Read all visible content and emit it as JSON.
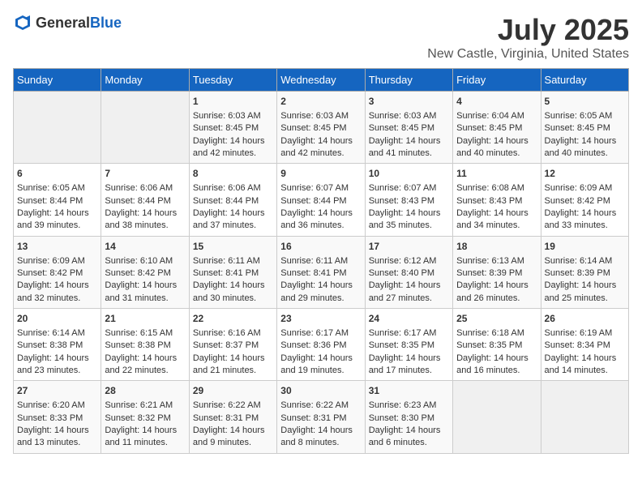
{
  "header": {
    "logo_general": "General",
    "logo_blue": "Blue",
    "title": "July 2025",
    "subtitle": "New Castle, Virginia, United States"
  },
  "weekdays": [
    "Sunday",
    "Monday",
    "Tuesday",
    "Wednesday",
    "Thursday",
    "Friday",
    "Saturday"
  ],
  "weeks": [
    [
      {
        "day": "",
        "info": ""
      },
      {
        "day": "",
        "info": ""
      },
      {
        "day": "1",
        "info": "Sunrise: 6:03 AM\nSunset: 8:45 PM\nDaylight: 14 hours\nand 42 minutes."
      },
      {
        "day": "2",
        "info": "Sunrise: 6:03 AM\nSunset: 8:45 PM\nDaylight: 14 hours\nand 42 minutes."
      },
      {
        "day": "3",
        "info": "Sunrise: 6:03 AM\nSunset: 8:45 PM\nDaylight: 14 hours\nand 41 minutes."
      },
      {
        "day": "4",
        "info": "Sunrise: 6:04 AM\nSunset: 8:45 PM\nDaylight: 14 hours\nand 40 minutes."
      },
      {
        "day": "5",
        "info": "Sunrise: 6:05 AM\nSunset: 8:45 PM\nDaylight: 14 hours\nand 40 minutes."
      }
    ],
    [
      {
        "day": "6",
        "info": "Sunrise: 6:05 AM\nSunset: 8:44 PM\nDaylight: 14 hours\nand 39 minutes."
      },
      {
        "day": "7",
        "info": "Sunrise: 6:06 AM\nSunset: 8:44 PM\nDaylight: 14 hours\nand 38 minutes."
      },
      {
        "day": "8",
        "info": "Sunrise: 6:06 AM\nSunset: 8:44 PM\nDaylight: 14 hours\nand 37 minutes."
      },
      {
        "day": "9",
        "info": "Sunrise: 6:07 AM\nSunset: 8:44 PM\nDaylight: 14 hours\nand 36 minutes."
      },
      {
        "day": "10",
        "info": "Sunrise: 6:07 AM\nSunset: 8:43 PM\nDaylight: 14 hours\nand 35 minutes."
      },
      {
        "day": "11",
        "info": "Sunrise: 6:08 AM\nSunset: 8:43 PM\nDaylight: 14 hours\nand 34 minutes."
      },
      {
        "day": "12",
        "info": "Sunrise: 6:09 AM\nSunset: 8:42 PM\nDaylight: 14 hours\nand 33 minutes."
      }
    ],
    [
      {
        "day": "13",
        "info": "Sunrise: 6:09 AM\nSunset: 8:42 PM\nDaylight: 14 hours\nand 32 minutes."
      },
      {
        "day": "14",
        "info": "Sunrise: 6:10 AM\nSunset: 8:42 PM\nDaylight: 14 hours\nand 31 minutes."
      },
      {
        "day": "15",
        "info": "Sunrise: 6:11 AM\nSunset: 8:41 PM\nDaylight: 14 hours\nand 30 minutes."
      },
      {
        "day": "16",
        "info": "Sunrise: 6:11 AM\nSunset: 8:41 PM\nDaylight: 14 hours\nand 29 minutes."
      },
      {
        "day": "17",
        "info": "Sunrise: 6:12 AM\nSunset: 8:40 PM\nDaylight: 14 hours\nand 27 minutes."
      },
      {
        "day": "18",
        "info": "Sunrise: 6:13 AM\nSunset: 8:39 PM\nDaylight: 14 hours\nand 26 minutes."
      },
      {
        "day": "19",
        "info": "Sunrise: 6:14 AM\nSunset: 8:39 PM\nDaylight: 14 hours\nand 25 minutes."
      }
    ],
    [
      {
        "day": "20",
        "info": "Sunrise: 6:14 AM\nSunset: 8:38 PM\nDaylight: 14 hours\nand 23 minutes."
      },
      {
        "day": "21",
        "info": "Sunrise: 6:15 AM\nSunset: 8:38 PM\nDaylight: 14 hours\nand 22 minutes."
      },
      {
        "day": "22",
        "info": "Sunrise: 6:16 AM\nSunset: 8:37 PM\nDaylight: 14 hours\nand 21 minutes."
      },
      {
        "day": "23",
        "info": "Sunrise: 6:17 AM\nSunset: 8:36 PM\nDaylight: 14 hours\nand 19 minutes."
      },
      {
        "day": "24",
        "info": "Sunrise: 6:17 AM\nSunset: 8:35 PM\nDaylight: 14 hours\nand 17 minutes."
      },
      {
        "day": "25",
        "info": "Sunrise: 6:18 AM\nSunset: 8:35 PM\nDaylight: 14 hours\nand 16 minutes."
      },
      {
        "day": "26",
        "info": "Sunrise: 6:19 AM\nSunset: 8:34 PM\nDaylight: 14 hours\nand 14 minutes."
      }
    ],
    [
      {
        "day": "27",
        "info": "Sunrise: 6:20 AM\nSunset: 8:33 PM\nDaylight: 14 hours\nand 13 minutes."
      },
      {
        "day": "28",
        "info": "Sunrise: 6:21 AM\nSunset: 8:32 PM\nDaylight: 14 hours\nand 11 minutes."
      },
      {
        "day": "29",
        "info": "Sunrise: 6:22 AM\nSunset: 8:31 PM\nDaylight: 14 hours\nand 9 minutes."
      },
      {
        "day": "30",
        "info": "Sunrise: 6:22 AM\nSunset: 8:31 PM\nDaylight: 14 hours\nand 8 minutes."
      },
      {
        "day": "31",
        "info": "Sunrise: 6:23 AM\nSunset: 8:30 PM\nDaylight: 14 hours\nand 6 minutes."
      },
      {
        "day": "",
        "info": ""
      },
      {
        "day": "",
        "info": ""
      }
    ]
  ]
}
